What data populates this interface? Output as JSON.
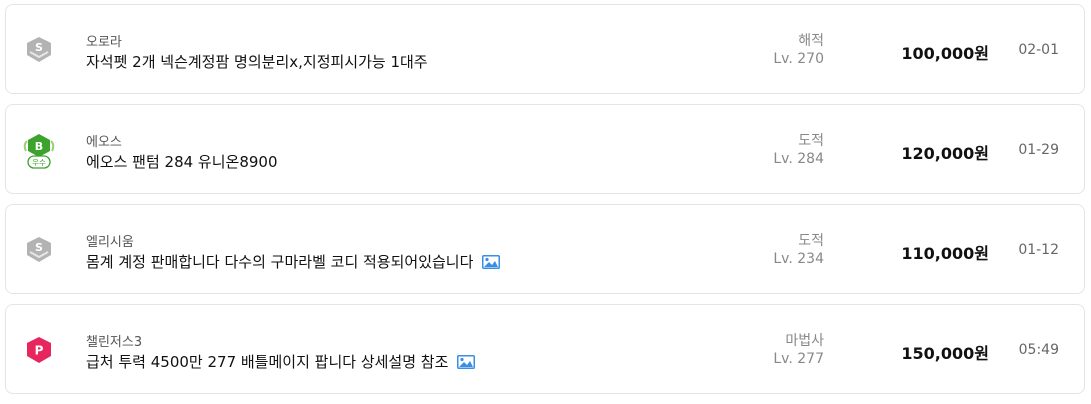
{
  "listings": [
    {
      "badge": "gray-s-grade-icon",
      "server": "오로라",
      "title": "자석펫 2개 넥슨계정팜 명의분리x,지정피시가능 1대주",
      "has_image": false,
      "job": "해적",
      "level": "Lv. 270",
      "price": "100,000원",
      "date": "02-01"
    },
    {
      "badge": "green-b-excellent-icon",
      "badge_letter": "B",
      "badge_text": "우수",
      "server": "에오스",
      "title": "에오스 팬텀 284 유니온8900",
      "has_image": false,
      "job": "도적",
      "level": "Lv. 284",
      "price": "120,000원",
      "date": "01-29"
    },
    {
      "badge": "gray-s-grade-icon",
      "server": "엘리시움",
      "title": "몸계 계정 판매합니다 다수의 구마라벨 코디 적용되어있습니다",
      "has_image": true,
      "job": "도적",
      "level": "Lv. 234",
      "price": "110,000원",
      "date": "01-12"
    },
    {
      "badge": "pink-p-grade-icon",
      "badge_letter": "P",
      "server": "챌린저스3",
      "title": "급처 투력 4500만 277 배틀메이지 팝니다 상세설명 참조",
      "has_image": true,
      "job": "마법사",
      "level": "Lv. 277",
      "price": "150,000원",
      "date": "05:49"
    }
  ]
}
